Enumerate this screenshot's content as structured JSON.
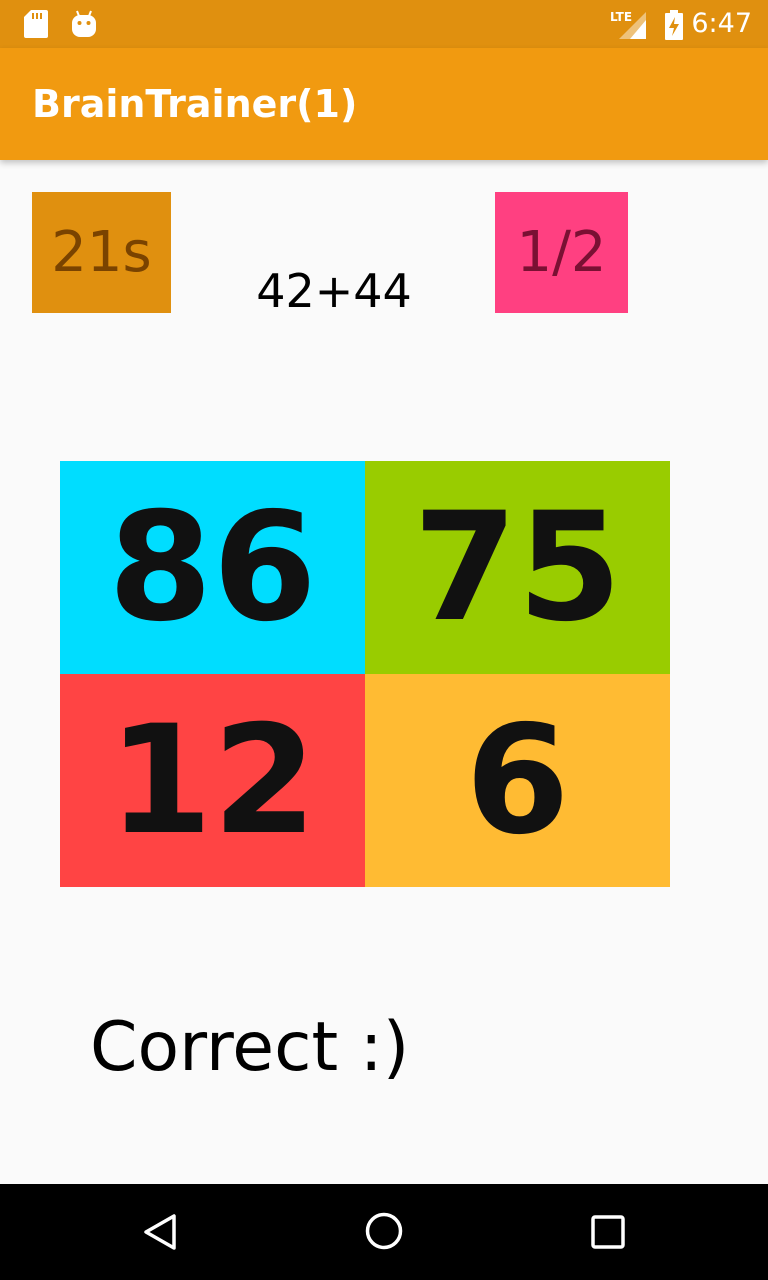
{
  "status_bar": {
    "time": "6:47",
    "network": "LTE",
    "bg_color": "#e0900f"
  },
  "app_bar": {
    "title": "BrainTrainer(1)",
    "bg_color": "#f19a10"
  },
  "game": {
    "timer": "21s",
    "question": "42+44",
    "score": "1/2",
    "answers": [
      "86",
      "75",
      "12",
      "6"
    ],
    "answer_colors": [
      "#00ddff",
      "#99cc00",
      "#ff4444",
      "#ffbb33"
    ],
    "result": "Correct :)"
  },
  "nav": {
    "icons": [
      "back-icon",
      "home-icon",
      "recents-icon"
    ]
  }
}
